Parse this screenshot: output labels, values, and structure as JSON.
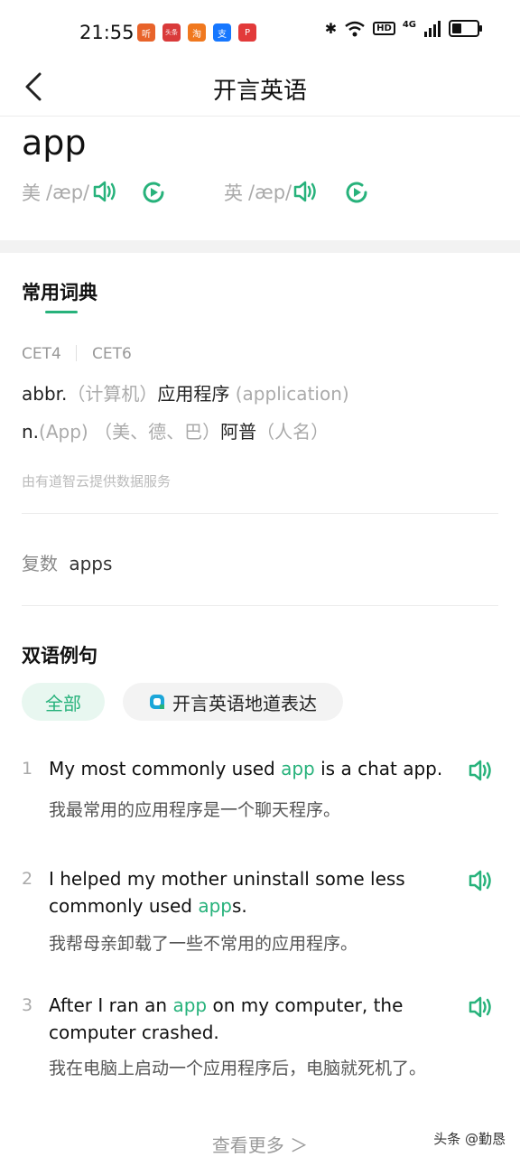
{
  "status_bar": {
    "time": "21:55",
    "app_badges": [
      {
        "text": "听",
        "color": "#e8632a"
      },
      {
        "text": "头条",
        "color": "#d93a3a"
      },
      {
        "text": "淘",
        "color": "#f0781e"
      },
      {
        "text": "支",
        "color": "#1677ff"
      },
      {
        "text": "P",
        "color": "#e23a3a"
      }
    ],
    "bluetooth": "✱",
    "hd": "HD",
    "network": "4G"
  },
  "header": {
    "title": "开言英语"
  },
  "word": {
    "text": "app",
    "us_label": "美",
    "us_phonetic": "/æp/",
    "uk_label": "英",
    "uk_phonetic": "/æp/"
  },
  "dictionary": {
    "title": "常用词典",
    "tags": [
      "CET4",
      "CET6"
    ],
    "definitions": [
      {
        "pos": "abbr.",
        "pre": "（计算机）",
        "meaning": "应用程序",
        "post": " (application)"
      },
      {
        "pos": "n.",
        "pre": "(App) （美、德、巴）",
        "meaning": "阿普",
        "post": "（人名）"
      }
    ],
    "source_note": "由有道智云提供数据服务",
    "plural_label": "复数",
    "plural_value": "apps"
  },
  "examples": {
    "title": "双语例句",
    "filters": [
      "全部",
      "开言英语地道表达"
    ],
    "items": [
      {
        "num": "1",
        "en_before": "My most commonly used ",
        "highlight": "app",
        "en_after": " is a chat app.",
        "zh": "我最常用的应用程序是一个聊天程序。"
      },
      {
        "num": "2",
        "en_before": "I helped my mother uninstall some less commonly used ",
        "highlight": "app",
        "en_after": "s.",
        "zh": "我帮母亲卸载了一些不常用的应用程序。"
      },
      {
        "num": "3",
        "en_before": "After I ran an ",
        "highlight": "app",
        "en_after": " on my computer, the computer crashed.",
        "zh": "我在电脑上启动一个应用程序后，电脑就死机了。"
      }
    ],
    "see_more": "查看更多 ＞"
  },
  "watermark": "头条 @勤恳",
  "colors": {
    "accent": "#27b27b",
    "divider": "#ececec"
  },
  "icons": [
    "back-arrow-icon",
    "speaker-icon",
    "replay-icon",
    "bluetooth-icon",
    "wifi-icon",
    "signal-icon",
    "battery-icon",
    "brand-logo-icon"
  ]
}
